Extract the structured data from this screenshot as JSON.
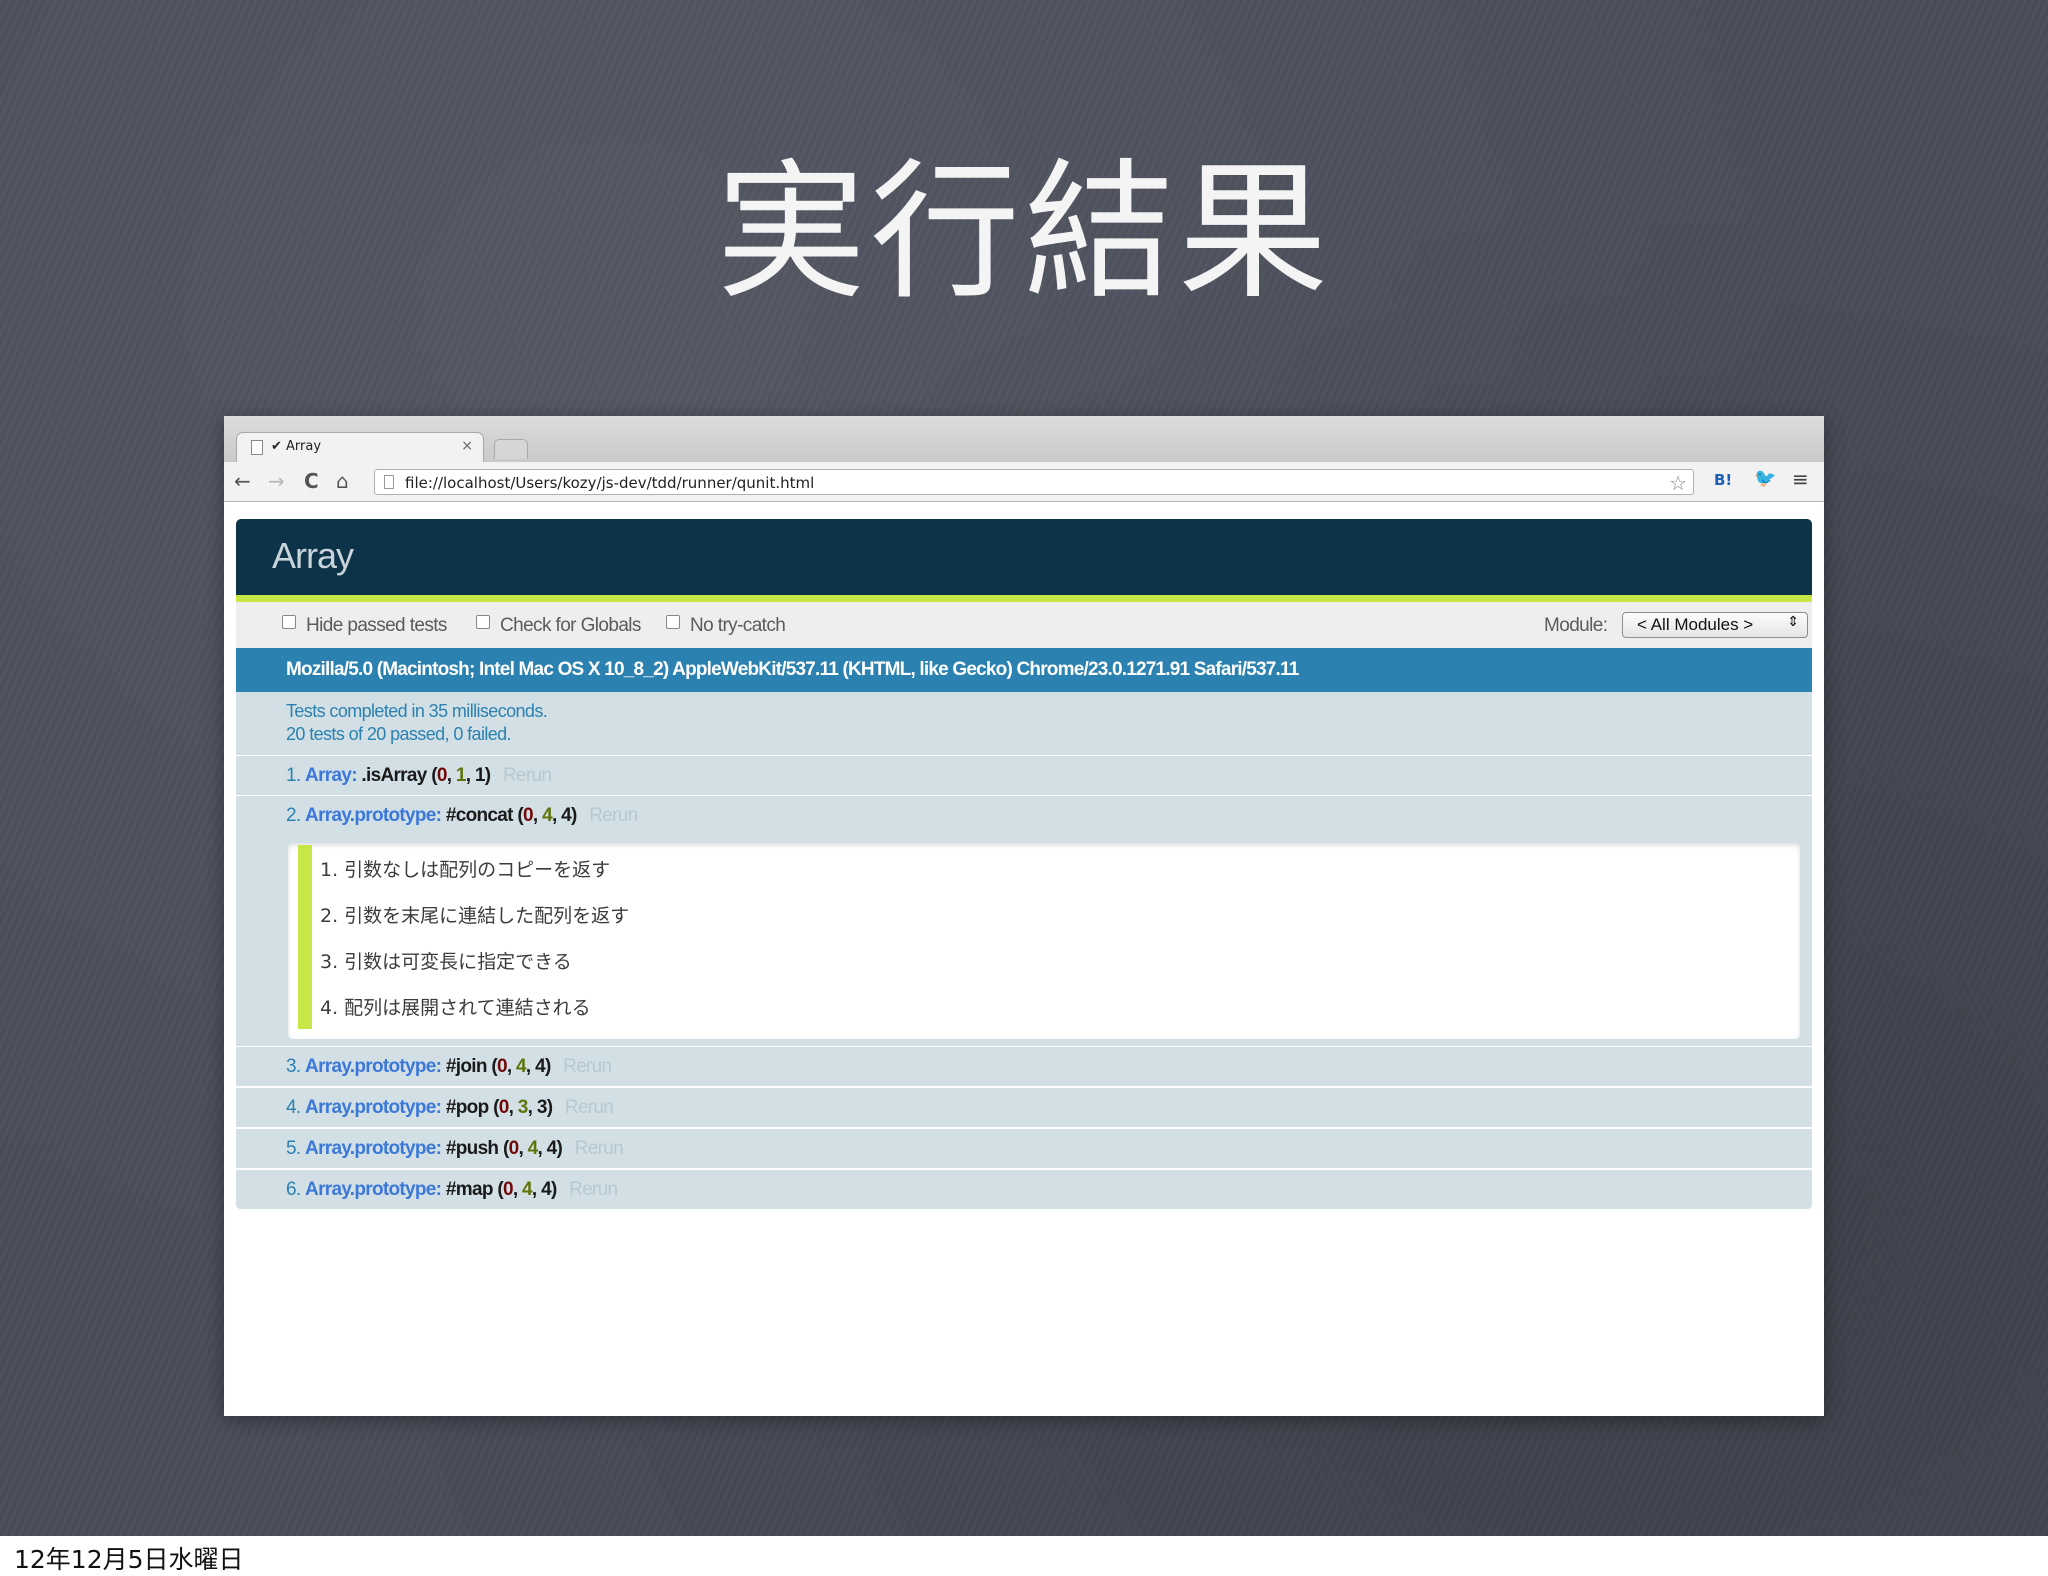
{
  "slide": {
    "title": "実行結果",
    "footer_date": "12年12月5日水曜日"
  },
  "browser": {
    "tab_title": "✔ Array",
    "tab_close": "×",
    "url": "file://localhost/Users/kozy/js-dev/tdd/runner/qunit.html",
    "back_icon": "←",
    "forward_icon": "→",
    "reload_icon": "C",
    "home_icon": "⌂",
    "star_icon": "☆",
    "ext_hatena": "B!",
    "ext_twitter": "🐦",
    "menu_icon": "≡"
  },
  "qunit": {
    "title": "Array",
    "toolbar": {
      "hide_passed": "Hide passed tests",
      "check_globals": "Check for Globals",
      "no_try_catch": "No try-catch",
      "module_label": "Module:",
      "module_value": "< All Modules >",
      "module_arrows": "⇕"
    },
    "user_agent": "Mozilla/5.0 (Macintosh; Intel Mac OS X 10_8_2) AppleWebKit/537.11 (KHTML, like Gecko) Chrome/23.0.1271.91 Safari/537.11",
    "result_line1": "Tests completed in 35 milliseconds.",
    "result_line2": "20 tests of 20 passed, 0 failed.",
    "rerun_label": "Rerun",
    "tests": [
      {
        "num": "1.",
        "module": "Array:",
        "name": ".isArray",
        "failed": "0",
        "passed": "1",
        "total": "1"
      },
      {
        "num": "2.",
        "module": "Array.prototype:",
        "name": "#concat",
        "failed": "0",
        "passed": "4",
        "total": "4"
      },
      {
        "num": "3.",
        "module": "Array.prototype:",
        "name": "#join",
        "failed": "0",
        "passed": "4",
        "total": "4"
      },
      {
        "num": "4.",
        "module": "Array.prototype:",
        "name": "#pop",
        "failed": "0",
        "passed": "3",
        "total": "3"
      },
      {
        "num": "5.",
        "module": "Array.prototype:",
        "name": "#push",
        "failed": "0",
        "passed": "4",
        "total": "4"
      },
      {
        "num": "6.",
        "module": "Array.prototype:",
        "name": "#map",
        "failed": "0",
        "passed": "4",
        "total": "4"
      }
    ],
    "assertions": [
      "1. 引数なしは配列のコピーを返す",
      "2. 引数を末尾に連結した配列を返す",
      "3. 引数は可変長に指定できる",
      "4. 配列は展開されて連結される"
    ],
    "colors": {
      "header_bg": "#0d3349",
      "pass_green": "#c6e746",
      "banner_blue": "#2b81af",
      "row_bg": "#d2e0e6"
    }
  }
}
